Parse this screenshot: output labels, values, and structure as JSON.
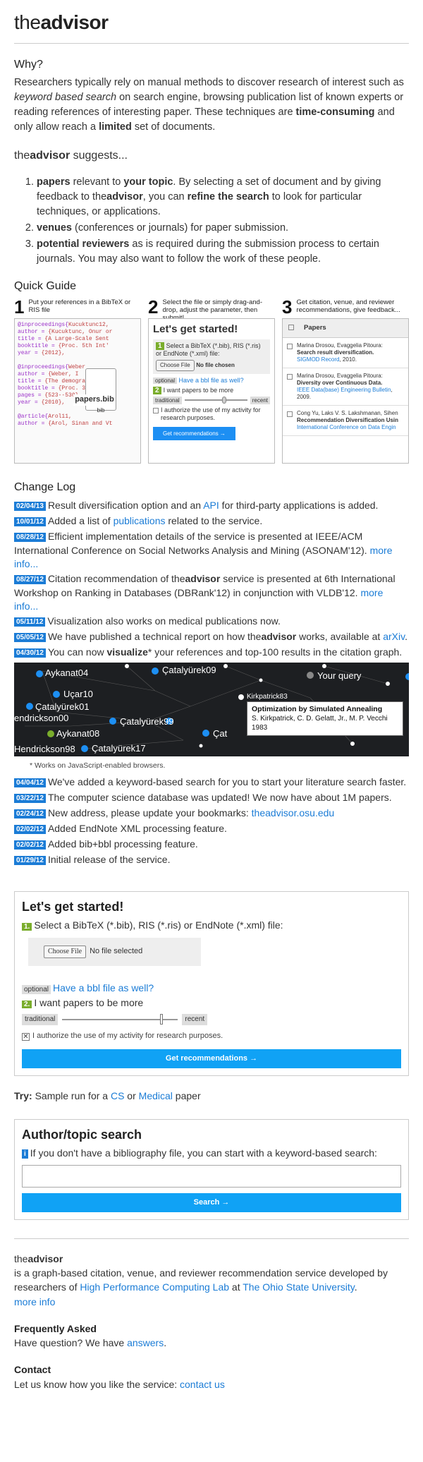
{
  "brand": {
    "prefix": "the",
    "bold": "advisor"
  },
  "why": {
    "heading": "Why?",
    "p1": "Researchers typically rely on manual methods to discover research of interest such as ",
    "p1_em": "keyword based search",
    "p2": " on search engine, browsing publication list of known experts or reading references of interesting paper. These techniques are ",
    "p2_b": "time-consuming",
    "p3": " and only allow reach a ",
    "p3_b": "limited",
    "p4": " set of documents."
  },
  "suggests": {
    "prefix": "the",
    "bold": "advisor",
    "suffix": " suggests...",
    "items": [
      {
        "b": "papers",
        "t1": " relevant to ",
        "b2": "your topic",
        "t2": ". By selecting a set of document and by giving feedback to the",
        "b3": "advisor",
        "t3": ", you can ",
        "b4": "refine the search",
        "t4": " to look for particular techniques, or applications."
      },
      {
        "b": "venues",
        "t1": " (conferences or journals) for paper submission."
      },
      {
        "b": "potential reviewers",
        "t1": " as is required during the submission process to certain journals. You may also want to follow the work of these people."
      }
    ]
  },
  "guide": {
    "heading": "Quick Guide",
    "steps": [
      {
        "num": "1",
        "text": "Put your references in a BibTeX or RIS file"
      },
      {
        "num": "2",
        "text": "Select the file or simply drag-and-drop, adjust the parameter, then submit!"
      },
      {
        "num": "3",
        "text": "Get citation, venue, and reviewer recommendations, give feedback..."
      }
    ],
    "code_lines": [
      {
        "k": "@inproceedings{",
        "v": "Kucuktunc12,"
      },
      {
        "k": "  author = ",
        "v": "{Kucuktunc, Onur or"
      },
      {
        "k": "  title = ",
        "v": "{A Large-Scale Sent"
      },
      {
        "k": "  booktitle = ",
        "v": "{Proc. 5th Int'"
      },
      {
        "k": "  year = ",
        "v": "{2012},"
      },
      {
        "k": "",
        "v": ""
      },
      {
        "k": "@inproceedings{",
        "v": "Weber"
      },
      {
        "k": "  author = ",
        "v": "{Weber, I"
      },
      {
        "k": "  title = ",
        "v": "{The demographics c"
      },
      {
        "k": "  booktitle = ",
        "v": "{Proc. 33rd Int"
      },
      {
        "k": "  pages = ",
        "v": "{523--530},"
      },
      {
        "k": "  year = ",
        "v": "{2010},"
      },
      {
        "k": "",
        "v": ""
      },
      {
        "k": "@article{",
        "v": "Arol11,"
      },
      {
        "k": "  author = ",
        "v": "{Arol, Sinan and Vt"
      }
    ],
    "file_label": "papers.bib",
    "file_ext": "bib",
    "mini": {
      "title": "Let's get started!",
      "select": "Select a BibTeX (*.bib), RIS (*.ris) or EndNote (*.xml) file:",
      "choose": "Choose File",
      "nofile": "No file chosen",
      "optional": "optional",
      "bbl": "Have a bbl file as well?",
      "want": "I want papers to be more",
      "traditional": "traditional",
      "recent": "recent",
      "authorize": "I authorize the use of my activity for research purposes.",
      "button": "Get recommendations →"
    },
    "papers_header": "Papers",
    "papers": [
      {
        "authors": "Marina Drosou, Evaggelia Pitoura:",
        "title": "Search result diversification.",
        "venue": "SIGMOD Record",
        "year": ", 2010."
      },
      {
        "authors": "Marina Drosou, Evaggelia Pitoura:",
        "title": "Diversity over Continuous Data.",
        "venue": "IEEE Data(base) Engineering Bulletin",
        "year": ", 2009."
      },
      {
        "authors": "Cong Yu, Laks V. S. Lakshmanan, Sihen",
        "title": "Recommendation Diversification Usin",
        "venue": "International Conference on Data Engin",
        "year": ""
      }
    ]
  },
  "changelog": {
    "heading": "Change Log",
    "entries1": [
      {
        "date": "02/04/13",
        "text": "Result diversification option and an ",
        "link": "API",
        "after": " for third-party applications is added."
      },
      {
        "date": "10/01/12",
        "text": "Added a list of ",
        "link": "publications",
        "after": " related to the service."
      },
      {
        "date": "08/28/12",
        "text": "Efficient implementation details of the service is presented at IEEE/ACM International Conference on Social Networks Analysis and Mining (ASONAM'12). ",
        "link": "more info...",
        "after": ""
      },
      {
        "date": "08/27/12",
        "text": "Citation recommendation of the",
        "bold": "advisor",
        "text2": " service is presented at 6th International Workshop on Ranking in Databases (DBRank'12) in conjunction with VLDB'12. ",
        "link": "more info...",
        "after": ""
      },
      {
        "date": "05/11/12",
        "text": "Visualization also works on medical publications now.",
        "link": "",
        "after": ""
      },
      {
        "date": "05/05/12",
        "text": "We have published a technical report on how the",
        "bold": "advisor",
        "text2": " works, available at ",
        "link": "arXiv",
        "after": "."
      },
      {
        "date": "04/30/12",
        "text": "You can now ",
        "bold": "visualize",
        "text2": "* your references and top-100 results in the citation graph.",
        "link": "",
        "after": ""
      }
    ],
    "graph": {
      "nodes": [
        "Aykanat04",
        "Çatalyürek09",
        "Your query",
        "Uçar10",
        "Kirkpatrick83",
        "Çatalyürek01",
        "endrickson00",
        "Aykanat08",
        "Çatalyürek99",
        "Çat",
        "Hendrickson98",
        "Çatalyürek17"
      ],
      "tooltip_title": "Optimization by Simulated Annealing",
      "tooltip_authors": "S. Kirkpatrick, C. D. Gelatt, Jr., M. P. Vecchi",
      "tooltip_year": "1983"
    },
    "note": "* Works on JavaScript-enabled browsers.",
    "entries2": [
      {
        "date": "04/04/12",
        "text": "We've added a keyword-based search for you to start your literature search faster.",
        "link": "",
        "after": ""
      },
      {
        "date": "03/22/12",
        "text": "The computer science database was updated! We now have about 1M papers.",
        "link": "",
        "after": ""
      },
      {
        "date": "02/24/12",
        "text": "New address, please update your bookmarks: ",
        "link": "theadvisor.osu.edu",
        "after": ""
      },
      {
        "date": "02/02/12",
        "text": "Added EndNote XML processing feature.",
        "link": "",
        "after": ""
      },
      {
        "date": "02/02/12",
        "text": "Added bib+bbl processing feature.",
        "link": "",
        "after": ""
      },
      {
        "date": "01/29/12",
        "text": "Initial release of the service.",
        "link": "",
        "after": ""
      }
    ]
  },
  "start": {
    "title": "Let's get started!",
    "step1_num": "1.",
    "step1": "Select a BibTeX (*.bib), RIS (*.ris) or EndNote (*.xml) file:",
    "choose": "Choose File",
    "nofile": "No file selected",
    "optional": "optional",
    "bbl": "Have a bbl file as well?",
    "step2_num": "2.",
    "step2": "I want papers to be more",
    "traditional": "traditional",
    "recent": "recent",
    "slider_value": 0.86,
    "authorize": "I authorize the use of my activity for research purposes.",
    "button": "Get recommendations →"
  },
  "try": {
    "label": "Try:",
    "text": " Sample run for a ",
    "cs": "CS",
    "or": " or ",
    "medical": "Medical",
    "after": " paper"
  },
  "search": {
    "title": "Author/topic search",
    "info": "i",
    "text": "If you don't have a bibliography file, you can start with a keyword-based search:",
    "value": "",
    "button": "Search →"
  },
  "footer": {
    "prefix": "the",
    "bold": "advisor",
    "desc": "is a graph-based citation, venue, and reviewer recommendation service developed by researchers of ",
    "link1": "High Performance Computing Lab",
    "mid": " at ",
    "link2": "The Ohio State University",
    "end": ".",
    "more": "more info",
    "faq_title": "Frequently Asked",
    "faq_text": "Have question? We have ",
    "faq_link": "answers",
    "faq_end": ".",
    "contact_title": "Contact",
    "contact_text": "Let us know how you like the service: ",
    "contact_link": "contact us"
  }
}
